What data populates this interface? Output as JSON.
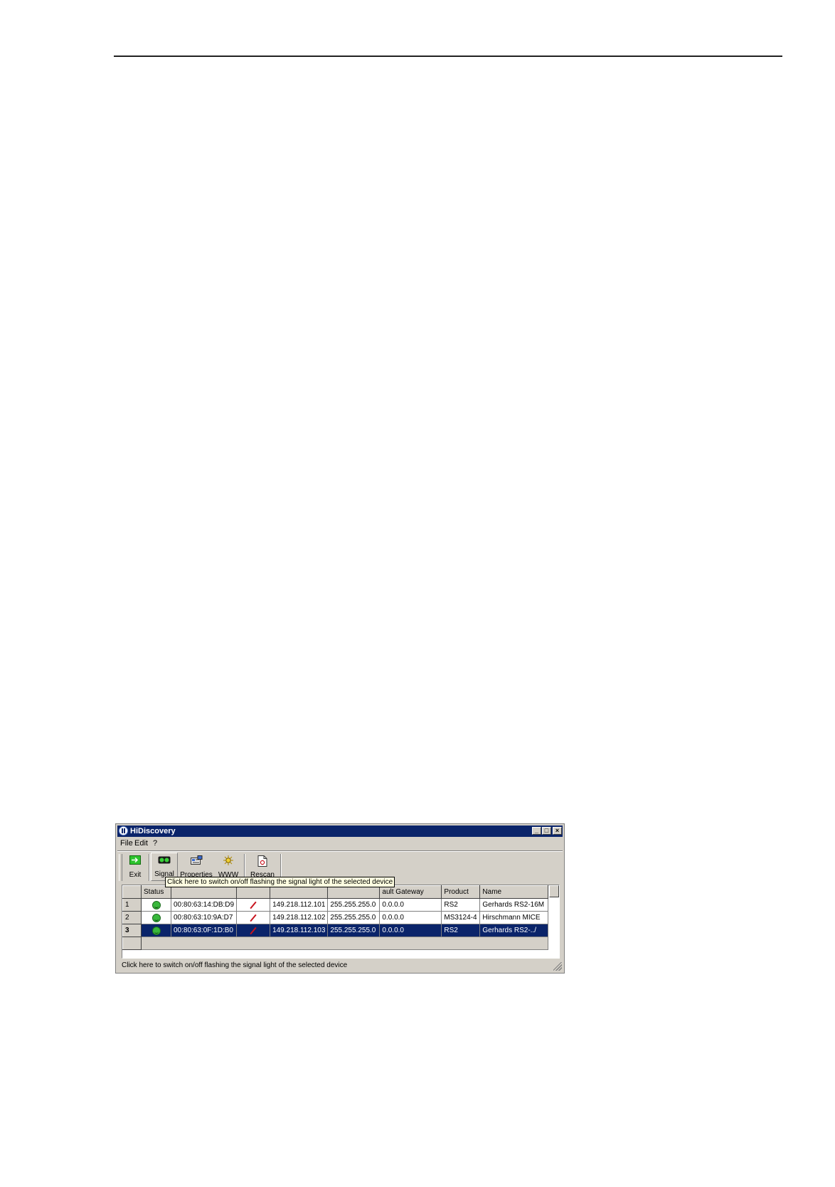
{
  "window": {
    "title": "HiDiscovery",
    "controls": [
      "_",
      "□",
      "×"
    ]
  },
  "menu": {
    "items": [
      "File",
      "Edit",
      "?"
    ]
  },
  "toolbar": {
    "buttons": [
      {
        "label": "Exit",
        "icon": "exit-icon"
      },
      {
        "label": "Signal",
        "icon": "signal-icon"
      },
      {
        "label": "Properties",
        "icon": "properties-icon"
      },
      {
        "label": "WWW",
        "icon": "www-icon"
      },
      {
        "label": "Rescan",
        "icon": "rescan-icon"
      }
    ]
  },
  "tooltip": "Click here to switch on/off flashing the signal light of the selected device",
  "table": {
    "columns": [
      "",
      "Status",
      "",
      "",
      "",
      "",
      "ault Gateway",
      "Product",
      "Name"
    ],
    "rows": [
      {
        "num": "1",
        "mac": "00:80:63:14:DB:D9",
        "ip": "149.218.112.101",
        "mask": "255.255.255.0",
        "gateway": "0.0.0.0",
        "product": "RS2",
        "name": "Gerhards RS2-16M"
      },
      {
        "num": "2",
        "mac": "00:80:63:10:9A:D7",
        "ip": "149.218.112.102",
        "mask": "255.255.255.0",
        "gateway": "0.0.0.0",
        "product": "MS3124-4",
        "name": "Hirschmann MICE"
      },
      {
        "num": "3",
        "mac": "00:80:63:0F:1D:B0",
        "ip": "149.218.112.103",
        "mask": "255.255.255.0",
        "gateway": "0.0.0.0",
        "product": "RS2",
        "name": "Gerhards RS2-../"
      }
    ],
    "selected_row": 3
  },
  "statusbar": {
    "text": "Click here to switch on/off flashing the signal light of the selected device"
  },
  "colors": {
    "titlebar": "#0a246a",
    "face": "#d4d0c8",
    "selection": "#0a246a",
    "tooltip": "#ffffe1"
  }
}
